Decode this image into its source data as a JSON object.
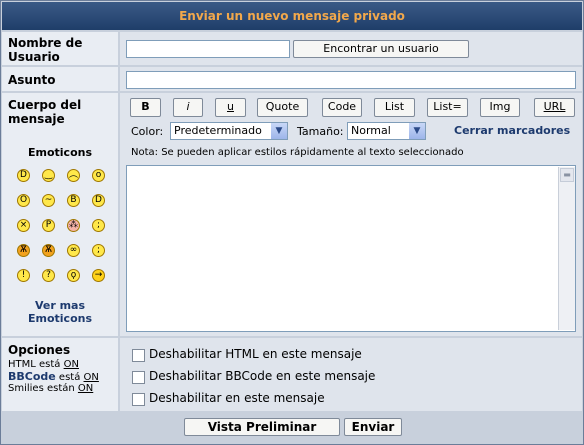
{
  "title": "Enviar un nuevo mensaje privado",
  "username": {
    "label": "Nombre de Usuario",
    "value": "",
    "find_button": "Encontrar un usuario"
  },
  "subject": {
    "label": "Asunto",
    "value": ""
  },
  "body": {
    "label": "Cuerpo del mensaje",
    "value": ""
  },
  "format_buttons": [
    "B",
    "i",
    "u",
    "Quote",
    "Code",
    "List",
    "List=",
    "Img",
    "URL"
  ],
  "color": {
    "label": "Color:",
    "selected": "Predeterminado"
  },
  "size": {
    "label": "Tamaño:",
    "selected": "Normal"
  },
  "close_tags": "Cerrar marcadores",
  "note": "Nota: Se pueden aplicar estilos rápidamente al texto seleccionado",
  "emoticons": {
    "title": "Emoticons",
    "more": "Ver mas Emoticons",
    "items": [
      "biggrin",
      "smile",
      "sad",
      "surprised",
      "shocked",
      "confused",
      "cool",
      "lol",
      "mad",
      "razz",
      "redface",
      "cry",
      "evil",
      "twisted",
      "rolleyes",
      "wink",
      "exclaim",
      "question",
      "idea",
      "arrow"
    ]
  },
  "options": {
    "label": "Opciones",
    "html_prefix": "HTML está",
    "html_state": "ON",
    "bbcode_label": "BBCode",
    "bbcode_suffix": "está",
    "bbcode_state": "ON",
    "smilies_prefix": "Smilies están",
    "smilies_state": "ON",
    "disable_html": "Deshabilitar HTML en este mensaje",
    "disable_bbcode": "Deshabilitar BBCode en este mensaje",
    "disable_smilies": "Deshabilitar en este mensaje"
  },
  "actions": {
    "preview": "Vista Preliminar",
    "send": "Enviar"
  }
}
